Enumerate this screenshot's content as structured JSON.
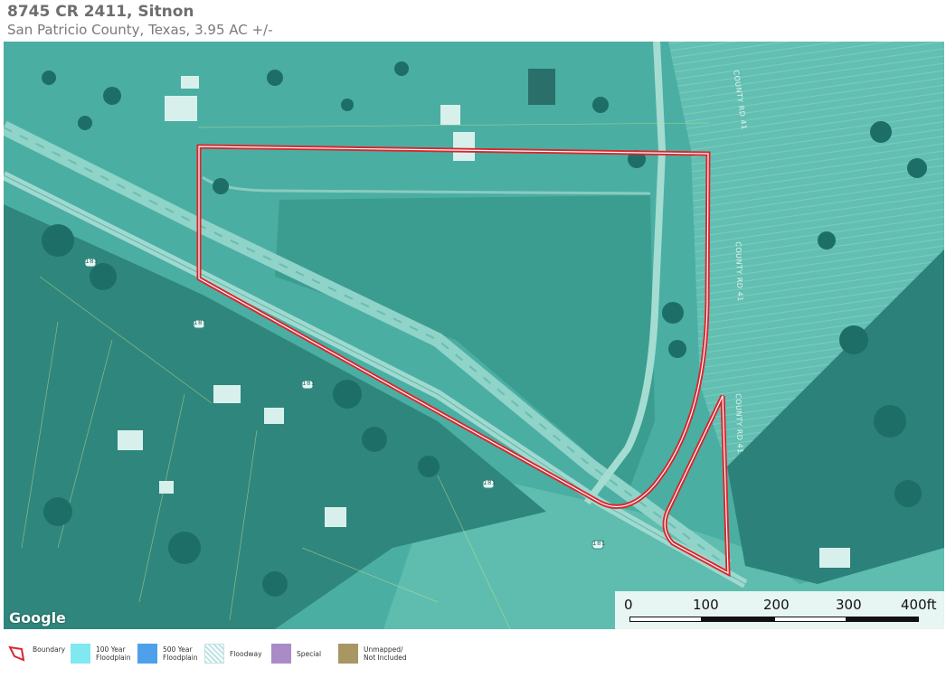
{
  "header": {
    "title": "8745 CR 2411, Sitnon",
    "subtitle": "San Patricio County, Texas, 3.95 AC +/-"
  },
  "map": {
    "attribution": "Google",
    "road_labels": {
      "county_rd_41_a": "COUNTY RD 41",
      "county_rd_41_b": "COUNTY RD 41",
      "county_rd_41_c": "COUNTY RD 41",
      "hwy_181_a": "181",
      "hwy_181_b": "181",
      "hwy_181_c": "181",
      "hwy_181_d": "181",
      "hwy_181_e": "181"
    },
    "scale": {
      "labels": [
        "0",
        "100",
        "200",
        "300",
        "400ft"
      ]
    },
    "colors": {
      "boundary": "#d9262e",
      "tint": "#3aa59e",
      "field": "#5bb9ad",
      "trees": "#1d6f6a"
    }
  },
  "legend": {
    "items": [
      {
        "label": "Boundary",
        "color": "#d9262e",
        "icon": "boundary-icon"
      },
      {
        "label": "100 Year\nFloodplain",
        "color": "#7fe8f0",
        "icon": "floodplain-100-swatch"
      },
      {
        "label": "500 Year\nFloodplain",
        "color": "#4fa0ea",
        "icon": "floodplain-500-swatch"
      },
      {
        "label": "Floodway",
        "color": "#bfe3e3",
        "icon": "floodway-swatch"
      },
      {
        "label": "Special",
        "color": "#a98bc6",
        "icon": "special-swatch"
      },
      {
        "label": "Unmapped/\nNot Included",
        "color": "#a89763",
        "icon": "unmapped-swatch"
      }
    ]
  }
}
